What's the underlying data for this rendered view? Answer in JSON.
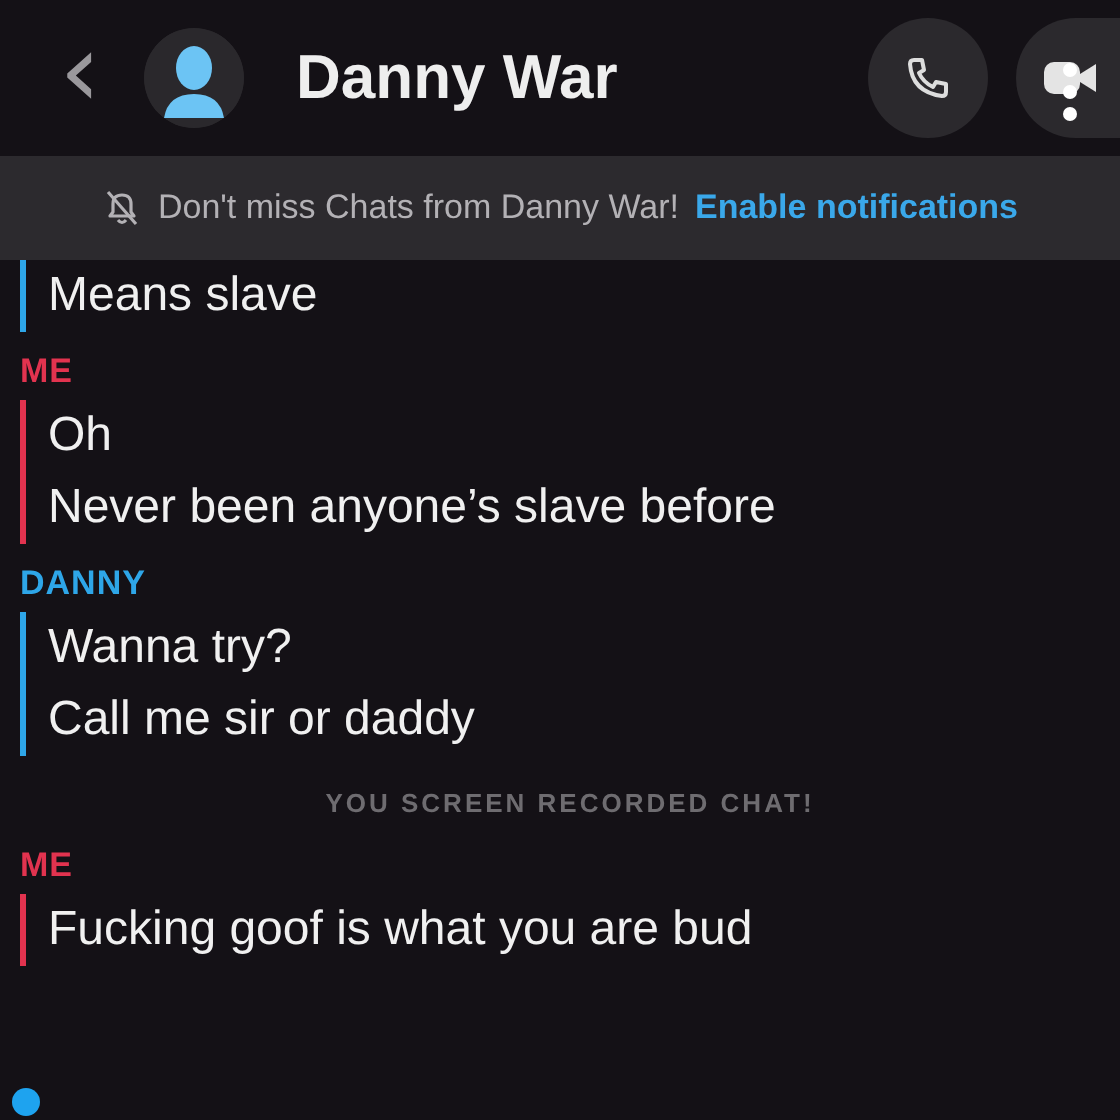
{
  "header": {
    "back": "‹",
    "name": "Danny War"
  },
  "banner": {
    "text": "Don't miss Chats from Danny War!",
    "link": "Enable notifications"
  },
  "messages": [
    {
      "kind": "group",
      "color": "#2ea6e8",
      "lines": [
        "Means slave"
      ]
    },
    {
      "kind": "group",
      "sender": "ME",
      "color": "#e2334f",
      "lines": [
        "Oh",
        "Never been anyone’s slave before"
      ]
    },
    {
      "kind": "group",
      "sender": "DANNY",
      "color": "#2ea6e8",
      "lines": [
        "Wanna try?",
        "Call me sir or daddy"
      ]
    },
    {
      "kind": "notice",
      "text": "YOU SCREEN RECORDED CHAT!"
    },
    {
      "kind": "group",
      "sender": "ME",
      "color": "#e2334f",
      "lines": [
        "Fucking goof is what you are bud"
      ]
    }
  ]
}
